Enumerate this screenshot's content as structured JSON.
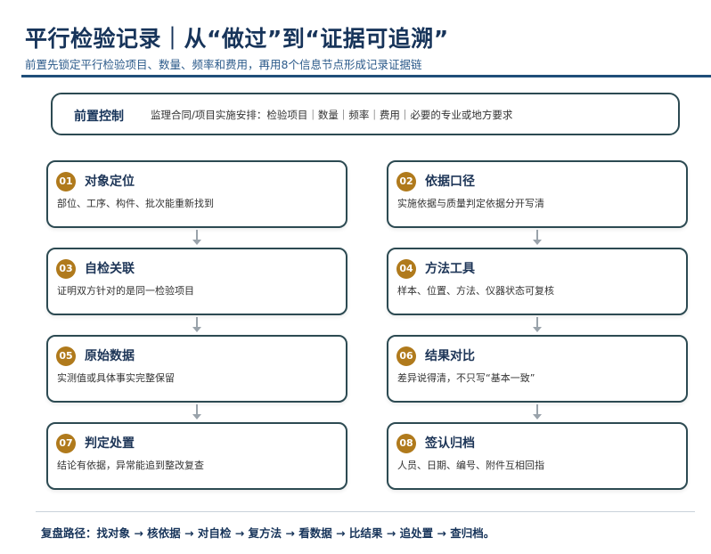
{
  "header": {
    "title": "平行检验记录｜从“做过”到“证据可追溯”",
    "subtitle": "前置先锁定平行检验项目、数量、频率和费用，再用8个信息节点形成记录证据链"
  },
  "pre_control": {
    "title": "前置控制",
    "text": "监理合同/项目实施安排：检验项目｜数量｜频率｜费用｜必要的专业或地方要求"
  },
  "steps": [
    {
      "num": "01",
      "title": "对象定位",
      "desc": "部位、工序、构件、批次能重新找到"
    },
    {
      "num": "02",
      "title": "依据口径",
      "desc": "实施依据与质量判定依据分开写清"
    },
    {
      "num": "03",
      "title": "自检关联",
      "desc": "证明双方针对的是同一检验项目"
    },
    {
      "num": "04",
      "title": "方法工具",
      "desc": "样本、位置、方法、仪器状态可复核"
    },
    {
      "num": "05",
      "title": "原始数据",
      "desc": "实测值或具体事实完整保留"
    },
    {
      "num": "06",
      "title": "结果对比",
      "desc": "差异说得清，不只写“基本一致”"
    },
    {
      "num": "07",
      "title": "判定处置",
      "desc": "结论有依据，异常能追到整改复查"
    },
    {
      "num": "08",
      "title": "签认归档",
      "desc": "人员、日期、编号、附件互相回指"
    }
  ],
  "footer": {
    "text": "复盘路径：找对象 → 核依据 → 对自检 → 复方法 → 看数据 → 比结果 → 追处置 → 查归档。"
  },
  "colors": {
    "title": "#17345a",
    "rule": "#1f4e79",
    "border": "#2c4a52",
    "badge": "#b07a1c",
    "arrow": "#9aa3ab"
  }
}
